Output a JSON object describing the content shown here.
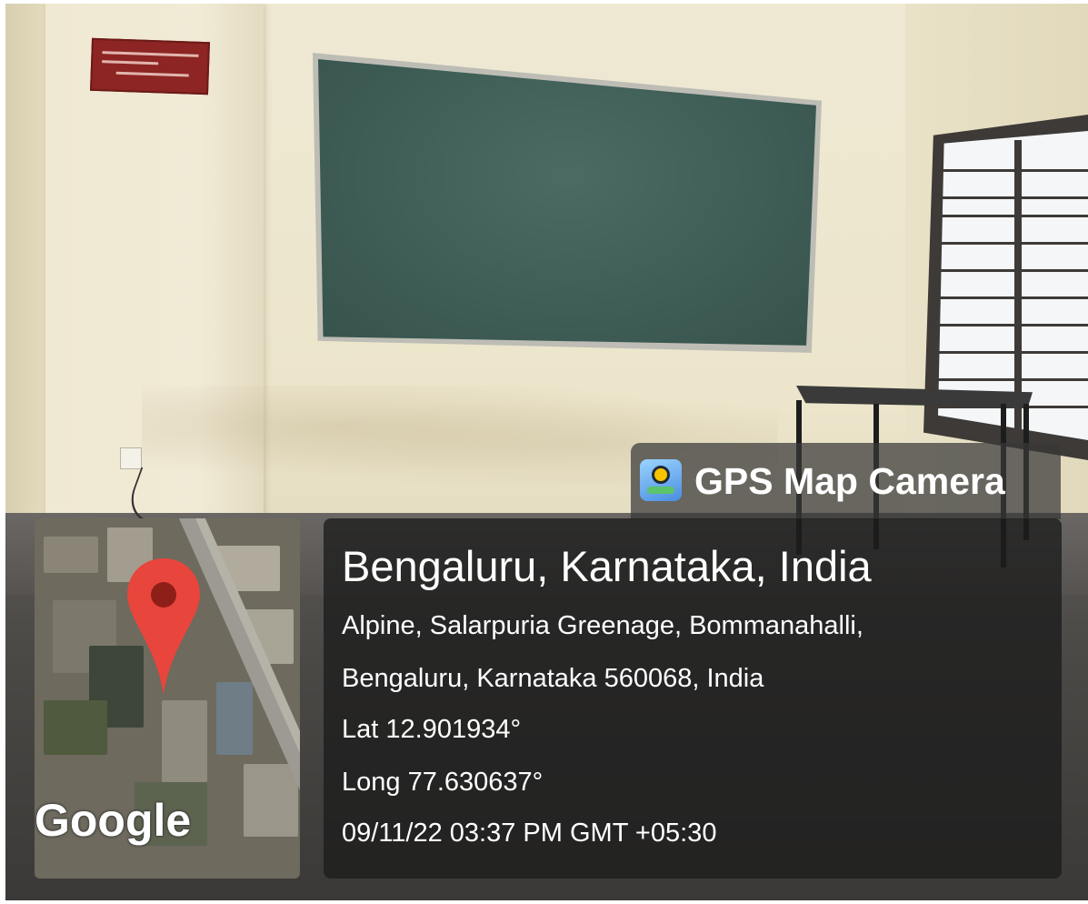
{
  "header": {
    "app_name": "GPS Map Camera",
    "app_icon": "gps-map-camera-app-icon"
  },
  "location": {
    "title": "Bengaluru, Karnataka, India",
    "address_line1": "Alpine, Salarpuria Greenage, Bommanahalli,",
    "address_line2": "Bengaluru, Karnataka 560068, India",
    "latitude": "Lat 12.901934°",
    "longitude": "Long 77.630637°",
    "datetime": "09/11/22 03:37 PM GMT +05:30"
  },
  "map": {
    "brand": "Google",
    "pin_icon": "map-pin-icon",
    "pin_color": "#e8453c"
  },
  "colors": {
    "panel_bg": "#1c1c1c",
    "text": "#ffffff",
    "board": "#3f5e56",
    "wall": "#efe9d4",
    "plaque": "#8c2523"
  }
}
